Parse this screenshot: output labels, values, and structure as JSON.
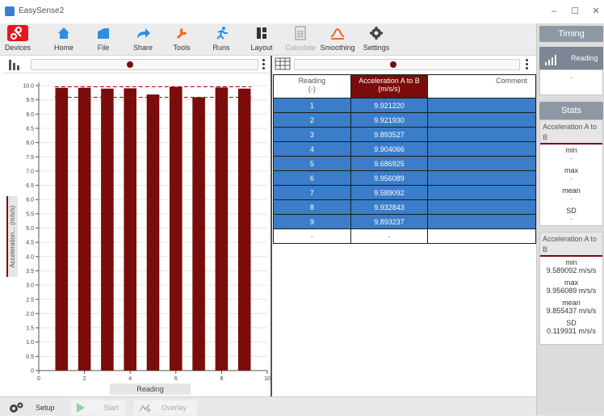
{
  "window": {
    "title": "EasySense2",
    "controls": [
      "–",
      "☐",
      "✕"
    ]
  },
  "toolbar": {
    "items": [
      {
        "label": "Devices",
        "icon": "devices-icon",
        "color": "#e0191b"
      },
      {
        "label": "Home",
        "icon": "home-icon",
        "color": "#2f8fde"
      },
      {
        "label": "File",
        "icon": "file-icon",
        "color": "#2f8fde"
      },
      {
        "label": "Share",
        "icon": "share-icon",
        "color": "#2f8fde"
      },
      {
        "label": "Tools",
        "icon": "tools-icon",
        "color": "#ee6a1c"
      },
      {
        "label": "Runs",
        "icon": "runs-icon",
        "color": "#2f8fde"
      },
      {
        "label": "Layout",
        "icon": "layout-icon",
        "color": "#333333"
      },
      {
        "label": "Calculate",
        "icon": "calculate-icon",
        "color": "#aaaaaa",
        "disabled": true
      },
      {
        "label": "Smoothing",
        "icon": "smoothing-icon",
        "color": "#ee6a1c"
      },
      {
        "label": "Settings",
        "icon": "settings-icon",
        "color": "#444444"
      }
    ]
  },
  "right_panel": {
    "timing_header": "Timing",
    "reading_button": "Reading",
    "reading_value": "-",
    "stats_header": "Stats",
    "stats_blank": {
      "title": "Acceleration A to B",
      "min_label": "min",
      "min_value": "-",
      "max_label": "max",
      "max_value": "-",
      "mean_label": "mean",
      "mean_value": "-",
      "sd_label": "SD",
      "sd_value": "-"
    },
    "stats_filled": {
      "title": "Acceleration A to B",
      "min_label": "min",
      "min_value": "9.589092 m/s/s",
      "max_label": "max",
      "max_value": "9.956089 m/s/s",
      "mean_label": "mean",
      "mean_value": "9.855437 m/s/s",
      "sd_label": "SD",
      "sd_value": "0.119931 m/s/s"
    }
  },
  "chart_data": {
    "type": "bar",
    "x": [
      1,
      2,
      3,
      4,
      5,
      6,
      7,
      8,
      9
    ],
    "values": [
      9.92122,
      9.92193,
      9.893527,
      9.904066,
      9.686925,
      9.956089,
      9.589092,
      9.932843,
      9.893237
    ],
    "xlabel": "Reading",
    "ylabel_prefix": "Acceleration...",
    "ylabel_unit": "(m/s/s)",
    "xlim": [
      0,
      10
    ],
    "ylim": [
      0,
      10
    ],
    "xticks": [
      "0",
      "2",
      "4",
      "6",
      "8",
      "10"
    ],
    "yticks": [
      "0",
      "0.5",
      "1.0",
      "1.5",
      "2.0",
      "2.5",
      "3.0",
      "3.5",
      "4.0",
      "4.5",
      "5.0",
      "5.5",
      "6.0",
      "6.5",
      "7.0",
      "7.5",
      "8.0",
      "8.5",
      "9.0",
      "9.5",
      "10.0"
    ],
    "bar_color": "#7a0c0c",
    "reference_lines": [
      9.956089,
      9.589092
    ],
    "grid": true
  },
  "table": {
    "headers": [
      {
        "line1": "Reading",
        "line2": "(-)"
      },
      {
        "line1": "Acceleration A to B",
        "line2": "(m/s/s)"
      },
      {
        "line1": "Comment",
        "line2": ""
      }
    ],
    "rows": [
      {
        "reading": "1",
        "value": "9.921220",
        "comment": ""
      },
      {
        "reading": "2",
        "value": "9.921930",
        "comment": ""
      },
      {
        "reading": "3",
        "value": "9.893527",
        "comment": ""
      },
      {
        "reading": "4",
        "value": "9.904066",
        "comment": ""
      },
      {
        "reading": "5",
        "value": "9.686925",
        "comment": ""
      },
      {
        "reading": "6",
        "value": "9.956089",
        "comment": ""
      },
      {
        "reading": "7",
        "value": "9.589092",
        "comment": ""
      },
      {
        "reading": "8",
        "value": "9.932843",
        "comment": ""
      },
      {
        "reading": "9",
        "value": "9.893237",
        "comment": ""
      }
    ],
    "empty_row": {
      "reading": "-",
      "value": "-",
      "comment": ""
    },
    "row_color": "#3b7dc8",
    "header_color": "#7a0c0c"
  },
  "bottombar": {
    "setup_label": "Setup",
    "start_label": "Start",
    "overlay_label": "Overlay"
  }
}
